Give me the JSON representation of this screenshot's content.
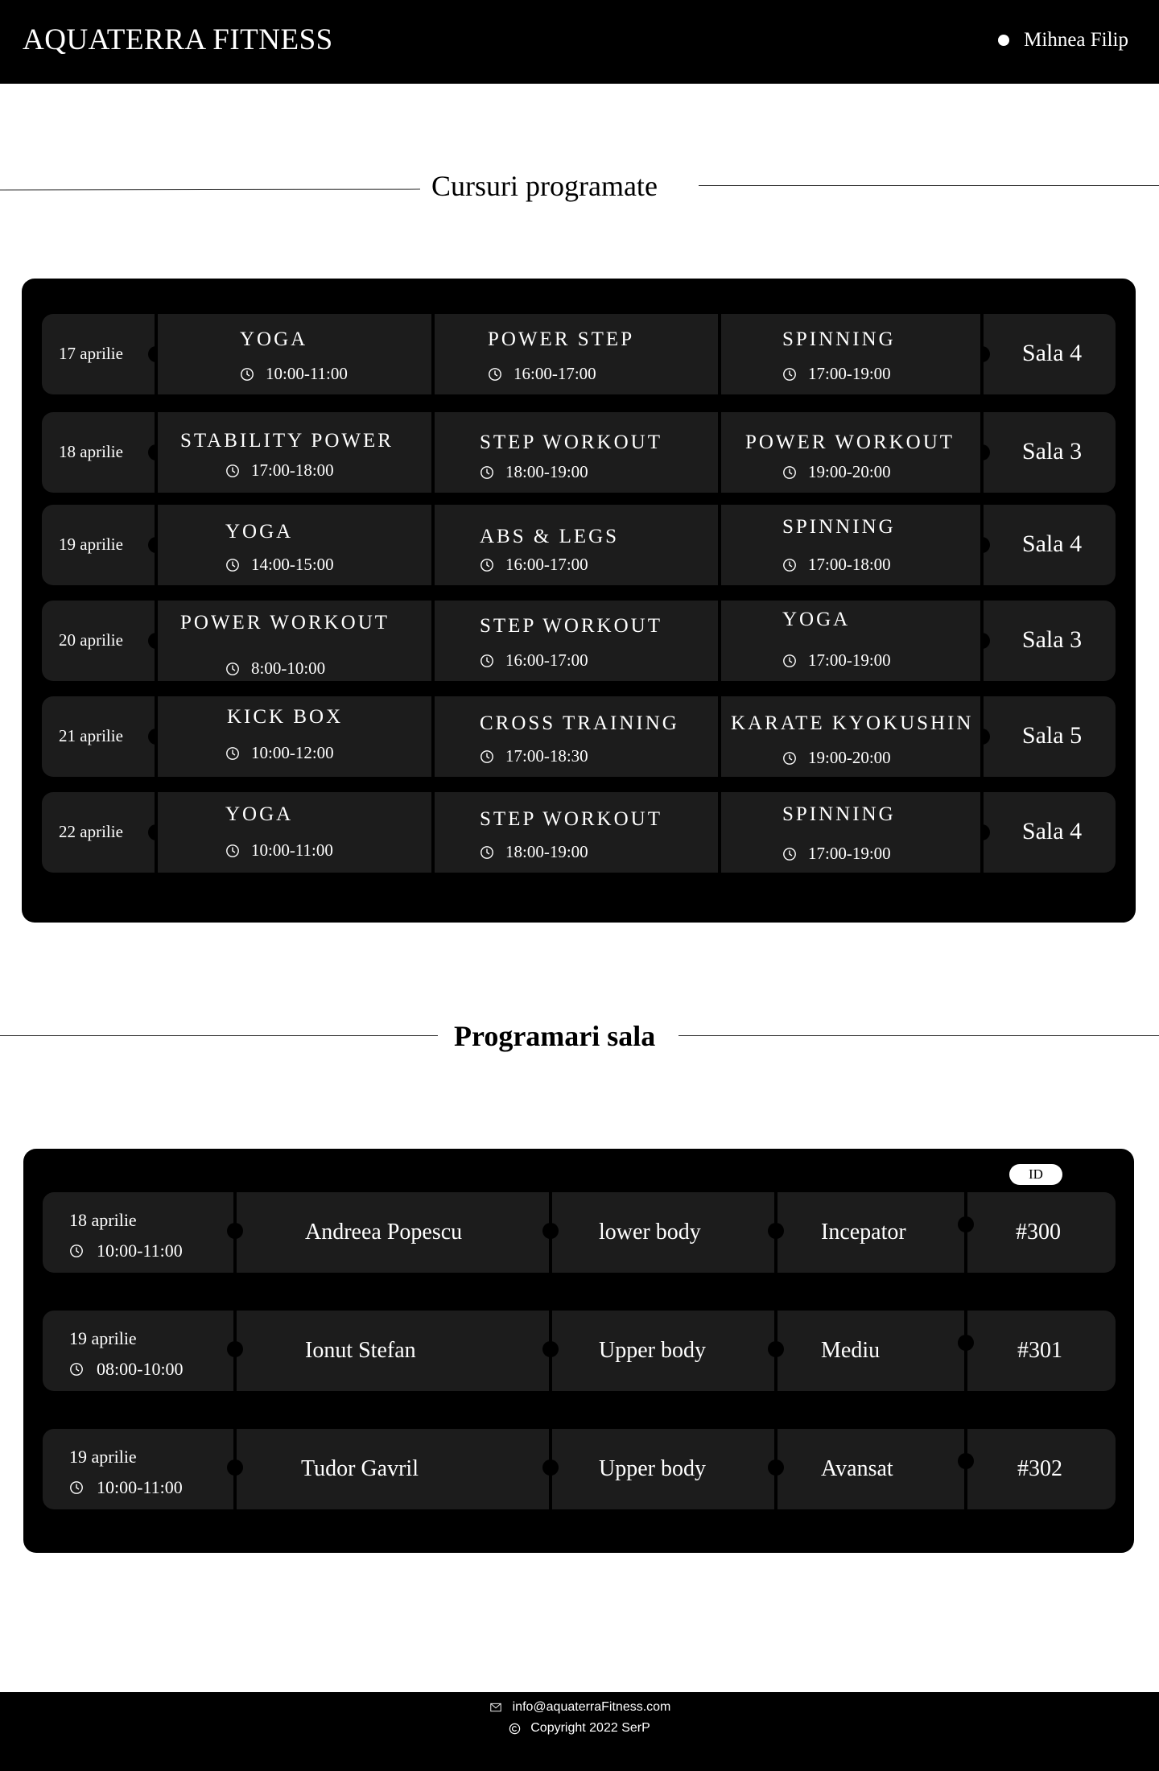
{
  "header": {
    "brand": "AQUATERRA FITNESS",
    "user_name": "Mihnea Filip"
  },
  "classes_section": {
    "title": "Cursuri programate"
  },
  "schedule": [
    {
      "date": "17 aprilie",
      "room": "Sala 4",
      "classes": [
        {
          "name": "YOGA",
          "time": "10:00-11:00"
        },
        {
          "name": "POWER STEP",
          "time": "16:00-17:00"
        },
        {
          "name": "SPINNING",
          "time": "17:00-19:00"
        }
      ]
    },
    {
      "date": "18 aprilie",
      "room": "Sala 3",
      "classes": [
        {
          "name": "STABILITY POWER",
          "time": "17:00-18:00"
        },
        {
          "name": "STEP WORKOUT",
          "time": "18:00-19:00"
        },
        {
          "name": "POWER WORKOUT",
          "time": "19:00-20:00"
        }
      ]
    },
    {
      "date": "19 aprilie",
      "room": "Sala 4",
      "classes": [
        {
          "name": "YOGA",
          "time": "14:00-15:00"
        },
        {
          "name": "ABS & LEGS",
          "time": "16:00-17:00"
        },
        {
          "name": "SPINNING",
          "time": "17:00-18:00"
        }
      ]
    },
    {
      "date": "20 aprilie",
      "room": "Sala 3",
      "classes": [
        {
          "name": "POWER WORKOUT",
          "time": "8:00-10:00"
        },
        {
          "name": "STEP WORKOUT",
          "time": "16:00-17:00"
        },
        {
          "name": "YOGA",
          "time": "17:00-19:00"
        }
      ]
    },
    {
      "date": "21 aprilie",
      "room": "Sala 5",
      "classes": [
        {
          "name": "KICK BOX",
          "time": "10:00-12:00"
        },
        {
          "name": "CROSS TRAINING",
          "time": "17:00-18:30"
        },
        {
          "name": "KARATE KYOKUSHIN",
          "time": "19:00-20:00"
        }
      ]
    },
    {
      "date": "22 aprilie",
      "room": "Sala 4",
      "classes": [
        {
          "name": "YOGA",
          "time": "10:00-11:00"
        },
        {
          "name": "STEP WORKOUT",
          "time": "18:00-19:00"
        },
        {
          "name": "SPINNING",
          "time": "17:00-19:00"
        }
      ]
    }
  ],
  "bookings_section": {
    "title": "Programari sala",
    "id_label": "ID"
  },
  "bookings": [
    {
      "date": "18 aprilie",
      "time": "10:00-11:00",
      "name": "Andreea Popescu",
      "workout": "lower body",
      "level": "Incepator",
      "id": "#300"
    },
    {
      "date": "19 aprilie",
      "time": "08:00-10:00",
      "name": "Ionut Stefan",
      "workout": "Upper body",
      "level": "Mediu",
      "id": "#301"
    },
    {
      "date": "19 aprilie",
      "time": "10:00-11:00",
      "name": "Tudor Gavril",
      "workout": "Upper body",
      "level": "Avansat",
      "id": "#302"
    }
  ],
  "footer": {
    "email": "info@aquaterraFitness.com",
    "copyright": "Copyright 2022 SerP"
  }
}
